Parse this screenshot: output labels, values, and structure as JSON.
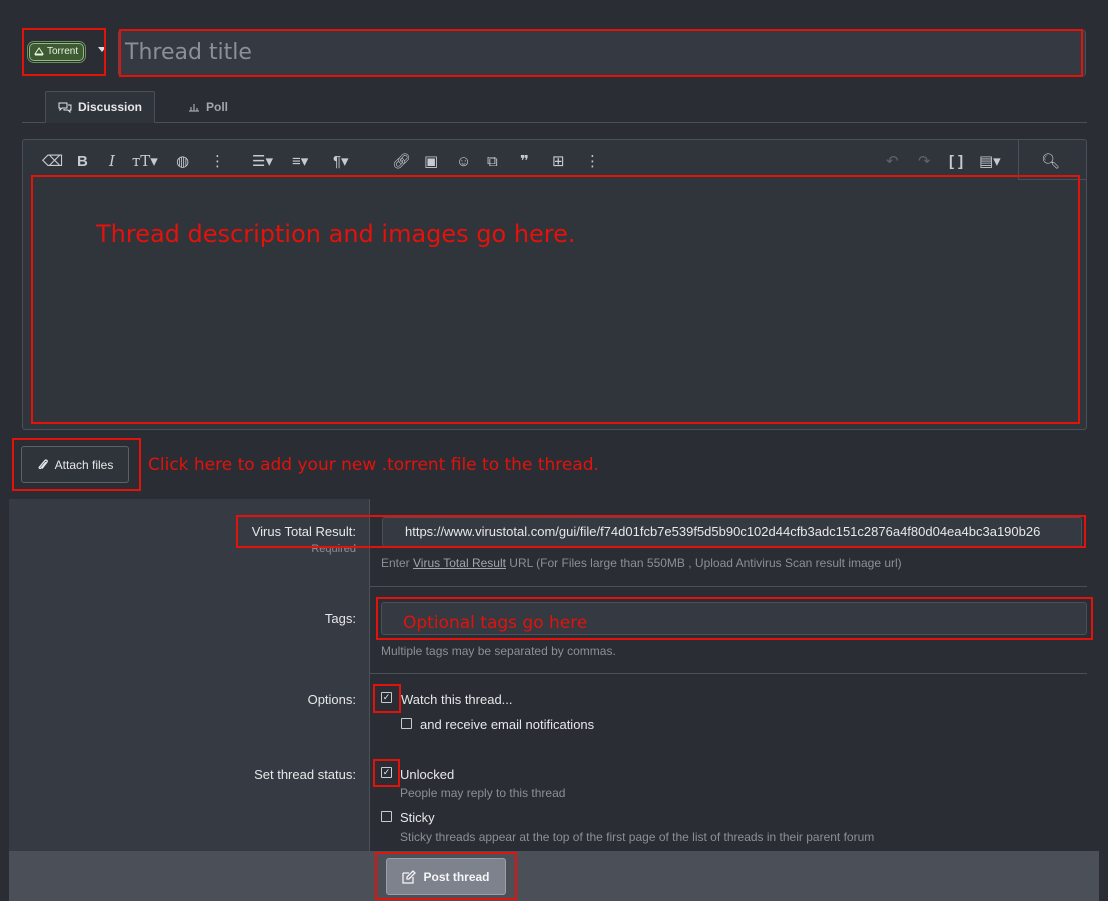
{
  "prefix": {
    "label": "Torrent"
  },
  "thread": {
    "title_placeholder": "Thread title"
  },
  "tabs": [
    {
      "label": "Discussion"
    },
    {
      "label": "Poll"
    }
  ],
  "annotations": {
    "description": "Thread description and images go here.",
    "attach": "Click here to add your new .torrent file to the thread.",
    "tags": "Optional tags go here"
  },
  "attach": {
    "label": "Attach files"
  },
  "virus_total": {
    "label": "Virus Total Result:",
    "required": "Required",
    "value": "https://www.virustotal.com/gui/file/f74d01fcb7e539f5d5b90c102d44cfb3adc151c2876a4f80d04ea4bc3a190b26",
    "hint_prefix": "Enter ",
    "hint_link": "Virus Total Result",
    "hint_suffix": " URL (For Files large than 550MB , Upload Antivirus Scan result image url)"
  },
  "tags": {
    "label": "Tags:",
    "hint": "Multiple tags may be separated by commas."
  },
  "options": {
    "label": "Options:",
    "watch": "Watch this thread...",
    "email": "and receive email notifications"
  },
  "status": {
    "label": "Set thread status:",
    "unlocked": "Unlocked",
    "unlocked_hint": "People may reply to this thread",
    "sticky": "Sticky",
    "sticky_hint": "Sticky threads appear at the top of the first page of the list of threads in their parent forum"
  },
  "submit": {
    "label": "Post thread"
  },
  "colors": {
    "annotation": "#e3120b",
    "background": "#2a2d34"
  }
}
